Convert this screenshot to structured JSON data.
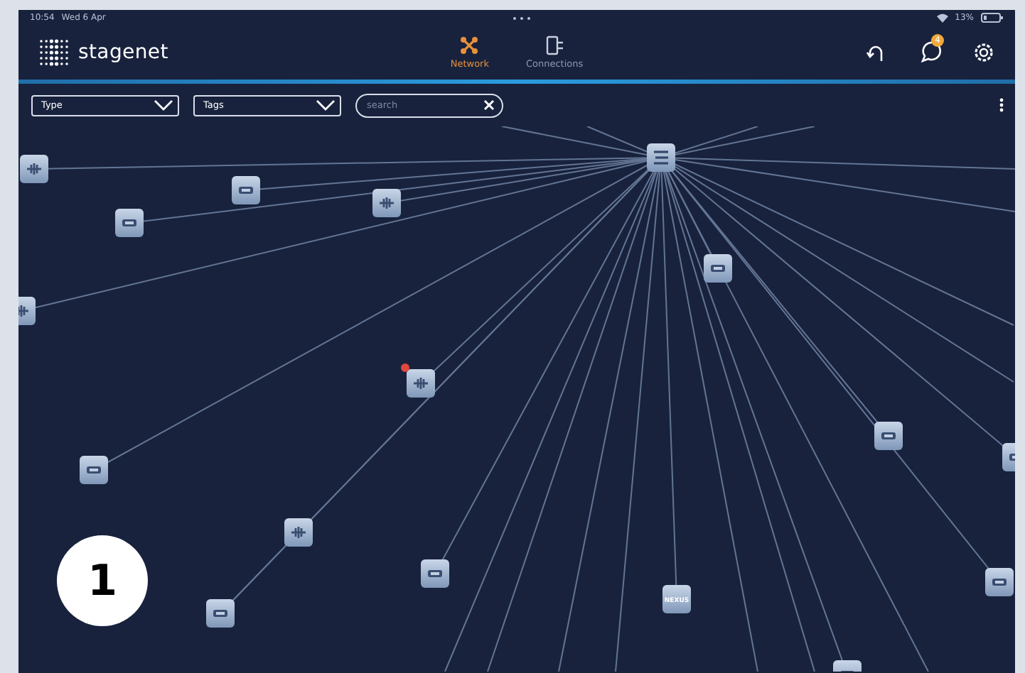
{
  "status_bar": {
    "time": "10:54",
    "date": "Wed 6 Apr",
    "battery": "13%"
  },
  "header": {
    "brand": "stagenet",
    "tabs": [
      {
        "label": "Network",
        "kind": "network",
        "selected": true
      },
      {
        "label": "Connections",
        "kind": "connections",
        "selected": false
      }
    ],
    "notification_count": "4"
  },
  "filters": [
    {
      "kind": "select",
      "label": "Type"
    },
    {
      "kind": "select",
      "label": "Tags"
    },
    {
      "kind": "search",
      "placeholder": "search"
    }
  ],
  "nodes": [
    {
      "kind": "hub",
      "alert": false
    },
    {
      "kind": "audio",
      "alert": false
    },
    {
      "kind": "video",
      "alert": false
    },
    {
      "kind": "video",
      "alert": false
    },
    {
      "kind": "audio",
      "alert": false
    },
    {
      "kind": "audio",
      "alert": false
    },
    {
      "kind": "video",
      "alert": false
    },
    {
      "kind": "audio",
      "alert": true
    },
    {
      "kind": "video",
      "alert": false
    },
    {
      "kind": "audio",
      "alert": false
    },
    {
      "kind": "video",
      "alert": false
    },
    {
      "kind": "video",
      "alert": false
    },
    {
      "kind": "nexus",
      "alert": false,
      "label": "NEXUS"
    },
    {
      "kind": "video",
      "alert": false
    },
    {
      "kind": "video",
      "alert": false
    },
    {
      "kind": "video",
      "alert": false
    },
    {
      "kind": "video",
      "alert": false
    }
  ],
  "callout": "1"
}
